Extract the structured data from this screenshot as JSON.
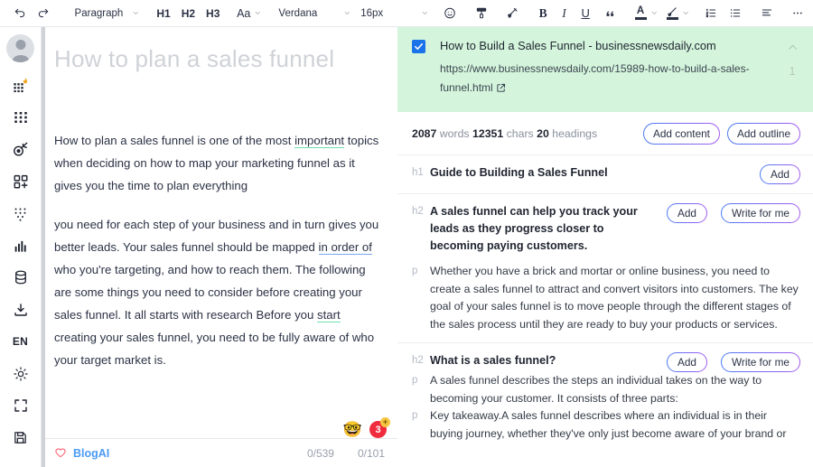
{
  "toolbar": {
    "undo_icon": "undo-icon",
    "redo_icon": "redo-icon",
    "block_style": "Paragraph",
    "h1": "H1",
    "h2": "H2",
    "h3": "H3",
    "case": "Aa",
    "font_family": "Verdana",
    "font_size": "16px",
    "emoji_icon": "emoji-icon",
    "format_paint_icon": "format-paint-icon",
    "highlight_pen_icon": "highlight-pen-icon",
    "bold": "B",
    "italic": "I",
    "underline": "U",
    "quote_icon": "blockquote-icon",
    "text_color": "A",
    "marker_icon": "text-highlight-icon",
    "ordered_list_icon": "ordered-list-icon",
    "bullet_list_icon": "bullet-list-icon",
    "align_icon": "align-left-icon",
    "more_icon": "more-horizontal-icon"
  },
  "rail": {
    "avatar": "user-avatar",
    "items": [
      {
        "name": "trending-grid-icon"
      },
      {
        "name": "grid-icon"
      },
      {
        "name": "comet-icon"
      },
      {
        "name": "add-module-icon"
      },
      {
        "name": "dots-grid-icon"
      },
      {
        "name": "bar-chart-icon"
      },
      {
        "name": "database-icon"
      },
      {
        "name": "download-icon"
      },
      {
        "name": "language-en",
        "label": "EN"
      },
      {
        "name": "brightness-icon"
      },
      {
        "name": "fullscreen-icon"
      },
      {
        "name": "save-icon"
      }
    ]
  },
  "editor": {
    "title_placeholder": "How to plan a sales funnel",
    "paragraphs": [
      {
        "parts": [
          {
            "text": "How to plan a sales funnel is one of the most "
          },
          {
            "text": "important",
            "underline": "green"
          },
          {
            "text": " topics when deciding on how to map your marketing funnel as it gives you the time to plan everything"
          }
        ]
      },
      {
        "parts": [
          {
            "text": "you need for each step of your business and in turn gives you better leads. Your sales funnel should be mapped "
          },
          {
            "text": "in order of",
            "underline": "blue"
          },
          {
            "text": " who you're targeting, and how to reach them. The following are some things you need to consider before creating your sales funnel. It all starts with research Before you "
          },
          {
            "text": "start",
            "underline": "green"
          },
          {
            "text": " creating your sales funnel, you need to be fully aware of who your target market is."
          }
        ]
      }
    ],
    "badges": {
      "emoji": "🤓",
      "count": "3",
      "plus": "+"
    },
    "footer": {
      "heart_icon": "heart-icon",
      "brand": "BlogAI",
      "count_left": "0/539",
      "count_right": "0/101"
    }
  },
  "result": {
    "checked": true,
    "check_icon": "check-icon",
    "title": "How to Build a Sales Funnel - businessnewsdaily.com",
    "url": "https://www.businessnewsdaily.com/15989-how-to-build-a-sales-funnel.html",
    "external_link_icon": "external-link-icon",
    "collapse_icon": "chevron-up-icon",
    "index": "1",
    "bg_color": "#d4f5dc"
  },
  "stats": {
    "words_value": "2087",
    "words_label": "words",
    "chars_value": "12351",
    "chars_label": "chars",
    "headings_value": "20",
    "headings_label": "headings",
    "add_content": "Add content",
    "add_outline": "Add outline"
  },
  "outline": {
    "add_label": "Add",
    "write_label": "Write for me",
    "blocks": [
      {
        "tag": "h1",
        "heading": "Guide to Building a Sales Funnel",
        "actions": [
          "add"
        ],
        "paragraphs": []
      },
      {
        "tag": "h2",
        "heading": "A sales funnel can help you track your leads as they progress closer to becoming paying customers.",
        "actions": [
          "add",
          "write"
        ],
        "paragraphs": [
          "Whether you have a brick and mortar or online business, you need to create a sales funnel to attract and convert visitors into customers. The key goal of your sales funnel is to move people through the different stages of the sales process until they are ready to buy your products or services."
        ]
      },
      {
        "tag": "h2",
        "heading": "What is a sales funnel?",
        "actions": [
          "add",
          "write"
        ],
        "paragraphs": [
          "A sales funnel describes the steps an individual takes on the way to becoming your customer. It consists of three parts:",
          "Key takeaway.A sales funnel describes where an individual is in their buying journey, whether they've only just become aware of your brand or"
        ]
      }
    ]
  }
}
